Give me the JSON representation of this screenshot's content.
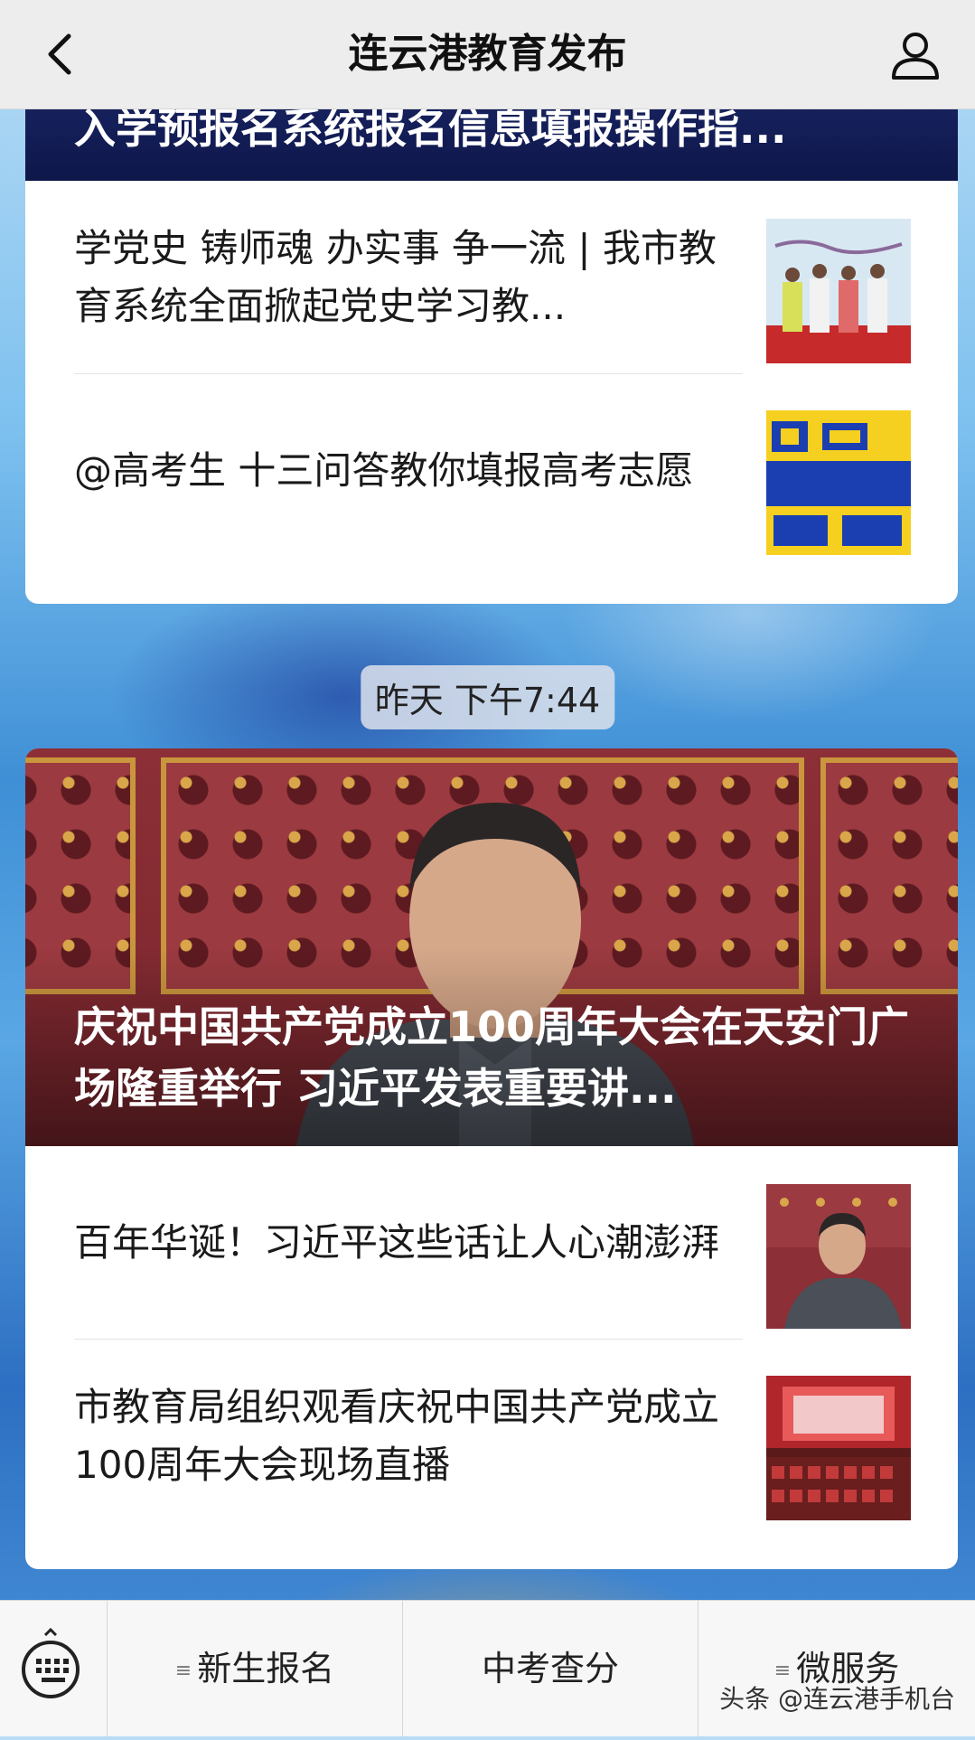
{
  "header": {
    "title": "连云港教育发布",
    "back_icon": "chevron-left-icon",
    "user_icon": "person-icon"
  },
  "card1": {
    "hero_title": "入学预报名系统报名信息填报操作指...",
    "items": [
      {
        "title": "学党史 铸师魂 办实事 争一流 | 我市教育系统全面掀起党史学习教..."
      },
      {
        "title": "@高考生 十三问答教你填报高考志愿"
      }
    ]
  },
  "timestamp": "昨天 下午7:44",
  "card2": {
    "hero_title": "庆祝中国共产党成立100周年大会在天安门广场隆重举行 习近平发表重要讲...",
    "items": [
      {
        "title": "百年华诞！习近平这些话让人心潮澎湃"
      },
      {
        "title": "市教育局组织观看庆祝中国共产党成立100周年大会现场直播"
      }
    ]
  },
  "bottom_menu": {
    "keyboard_icon": "keyboard-icon",
    "items": [
      {
        "label": "新生报名",
        "has_submenu": true
      },
      {
        "label": "中考查分",
        "has_submenu": false
      },
      {
        "label": "微服务",
        "has_submenu": true
      }
    ]
  },
  "watermark": "头条 @连云港手机台",
  "colors": {
    "header_bg": "#ededed",
    "hero_dark_blue": "#0e174a",
    "card_bg": "#ffffff"
  }
}
